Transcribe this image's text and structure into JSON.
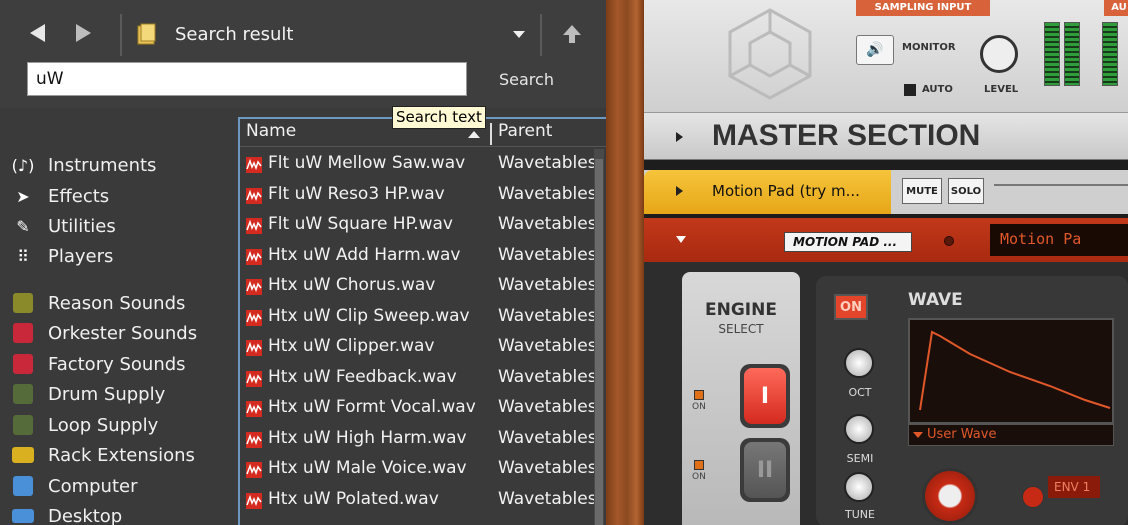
{
  "browser": {
    "location": "Search result",
    "search": {
      "value": "uW",
      "placeholder": "",
      "button_label": "Search",
      "tooltip": "Search text"
    },
    "columns": {
      "name": "Name",
      "parent": "Parent"
    },
    "categories": [
      {
        "label": "Instruments",
        "icon": "music-note-icon"
      },
      {
        "label": "Effects",
        "icon": "effects-icon"
      },
      {
        "label": "Utilities",
        "icon": "utilities-icon"
      },
      {
        "label": "Players",
        "icon": "players-grid-icon"
      }
    ],
    "locations": [
      {
        "label": "Reason Sounds",
        "icon": "reason-sounds-icon",
        "color": "#8a8a2a"
      },
      {
        "label": "Orkester Sounds",
        "icon": "orkester-sounds-icon",
        "color": "#c8283a"
      },
      {
        "label": "Factory Sounds",
        "icon": "factory-sounds-icon",
        "color": "#c8283a"
      },
      {
        "label": "Drum Supply",
        "icon": "drum-supply-icon",
        "color": "#556b3a"
      },
      {
        "label": "Loop Supply",
        "icon": "loop-supply-icon",
        "color": "#556b3a"
      },
      {
        "label": "Rack Extensions",
        "icon": "rack-extensions-icon",
        "color": "#d8b020"
      },
      {
        "label": "Computer",
        "icon": "computer-icon",
        "color": "#4a90d9"
      },
      {
        "label": "Desktop",
        "icon": "desktop-icon",
        "color": "#4a90d9"
      }
    ],
    "files": [
      {
        "name": "Flt uW Mellow Saw.wav",
        "parent": "Wavetables"
      },
      {
        "name": "Flt uW Reso3 HP.wav",
        "parent": "Wavetables"
      },
      {
        "name": "Flt uW Square HP.wav",
        "parent": "Wavetables"
      },
      {
        "name": "Htx uW Add Harm.wav",
        "parent": "Wavetables"
      },
      {
        "name": "Htx uW Chorus.wav",
        "parent": "Wavetables"
      },
      {
        "name": "Htx uW Clip Sweep.wav",
        "parent": "Wavetables"
      },
      {
        "name": "Htx uW Clipper.wav",
        "parent": "Wavetables"
      },
      {
        "name": "Htx uW Feedback.wav",
        "parent": "Wavetables"
      },
      {
        "name": "Htx uW Formt Vocal.wav",
        "parent": "Wavetables"
      },
      {
        "name": "Htx uW High Harm.wav",
        "parent": "Wavetables"
      },
      {
        "name": "Htx uW Male Voice.wav",
        "parent": "Wavetables"
      },
      {
        "name": "Htx uW Polated.wav",
        "parent": "Wavetables"
      }
    ]
  },
  "rack": {
    "sampling_input": "SAMPLING INPUT",
    "sampling_input_2": "AU",
    "monitor": "MONITOR",
    "auto": "AUTO",
    "level": "LEVEL",
    "master": "MASTER SECTION",
    "track": {
      "name": "Motion Pad  (try m...",
      "mute": "MUTE",
      "solo": "SOLO"
    },
    "device": {
      "patch": "MOTION PAD   ...",
      "display": "Motion Pa"
    },
    "engine": {
      "title": "ENGINE",
      "subtitle": "SELECT",
      "btn1": "I",
      "btn2": "II",
      "on1": "ON",
      "on2": "ON"
    },
    "wave": {
      "on": "ON",
      "title": "WAVE",
      "selector": "User Wave",
      "oct": "OCT",
      "semi": "SEMI",
      "tune": "TUNE",
      "env": "ENV 1"
    }
  }
}
